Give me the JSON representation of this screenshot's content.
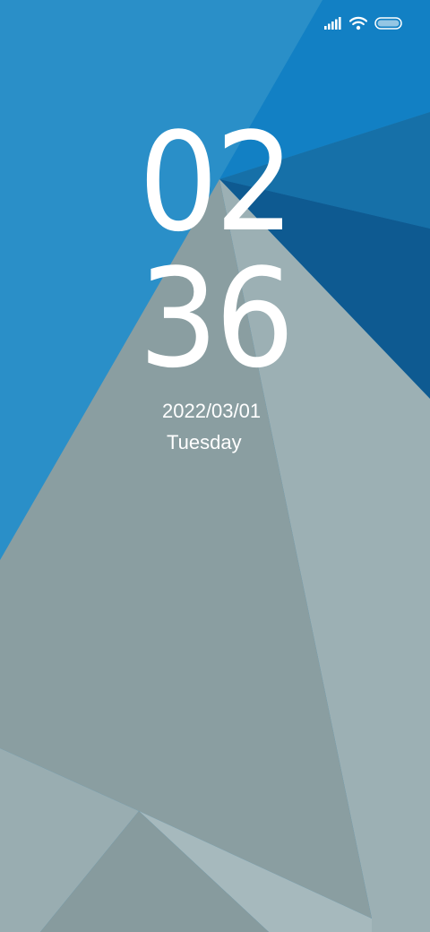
{
  "lock_screen": {
    "clock": {
      "hours": "02",
      "minutes": "36"
    },
    "date": "2022/03/01",
    "weekday": "Tuesday"
  },
  "status_bar": {
    "icons": [
      "signal-icon",
      "wifi-icon",
      "battery-icon"
    ]
  },
  "colors": {
    "sky_blue": "#2a8fc8",
    "deep_blue": "#0f6eb0",
    "navy": "#0c5a92",
    "grey_light": "#9cb0b4",
    "grey_mid": "#8a9ea1",
    "text": "#ffffff"
  }
}
